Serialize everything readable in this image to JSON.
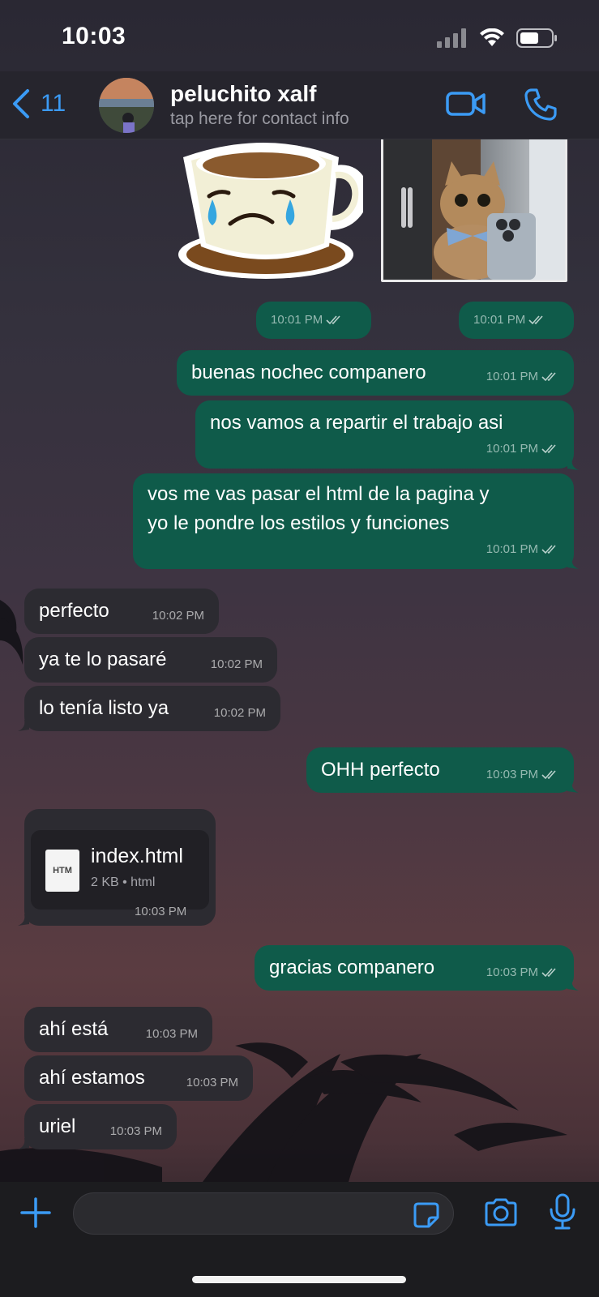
{
  "status_bar": {
    "time": "10:03"
  },
  "header": {
    "back_count": "11",
    "contact_name": "peluchito xalf",
    "contact_subtitle": "tap here for contact info"
  },
  "messages": [
    {
      "dir": "out",
      "time": "10:01 PM"
    },
    {
      "dir": "out",
      "time": "10:01 PM"
    },
    {
      "dir": "out",
      "text": "buenas nochec companero",
      "time": "10:01 PM"
    },
    {
      "dir": "out",
      "text": "nos vamos a repartir el trabajo asi",
      "time": "10:01 PM"
    },
    {
      "dir": "out",
      "line1": "vos me vas pasar el html de la pagina y",
      "line2": "yo le pondre los estilos y funciones",
      "time": "10:01 PM"
    },
    {
      "dir": "in",
      "text": "perfecto",
      "time": "10:02 PM"
    },
    {
      "dir": "in",
      "text": "ya te lo pasaré",
      "time": "10:02 PM"
    },
    {
      "dir": "in",
      "text": "lo tenía listo ya",
      "time": "10:02 PM"
    },
    {
      "dir": "out",
      "text": "OHH perfecto",
      "time": "10:03 PM"
    },
    {
      "dir": "in",
      "file": {
        "type_label": "HTM",
        "name": "index.html",
        "meta": "2 KB • html"
      },
      "time": "10:03 PM"
    },
    {
      "dir": "out",
      "text": "gracias companero",
      "time": "10:03 PM"
    },
    {
      "dir": "in",
      "text": "ahí está",
      "time": "10:03 PM"
    },
    {
      "dir": "in",
      "text": "ahí estamos",
      "time": "10:03 PM"
    },
    {
      "dir": "in",
      "text": "uriel",
      "time": "10:03 PM"
    }
  ],
  "composer": {
    "placeholder": ""
  },
  "colors": {
    "accent": "#3b9bf5",
    "outgoing_bubble": "#0f5b4a",
    "incoming_bubble": "#2c2b31"
  }
}
